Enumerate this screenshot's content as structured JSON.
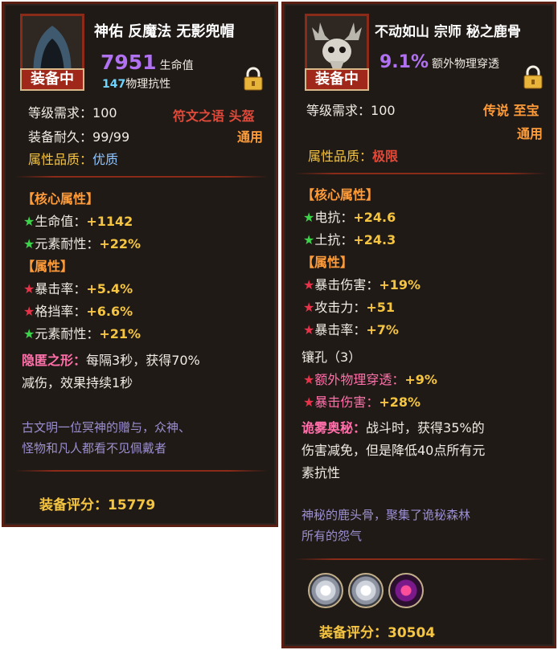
{
  "left": {
    "badge": "装备中",
    "name": "神佑 反魔法 无影兜帽",
    "main_stat_value": "7951",
    "main_stat_label": "生命值",
    "sub_stat_value": "147",
    "sub_stat_label": "物理抗性",
    "level_label": "等级需求：",
    "level_value": "100",
    "rune_text": "符文之语",
    "slot_text": "头盔",
    "durability_label": "装备耐久：",
    "durability_value": "99/99",
    "usage": "通用",
    "quality_label": "属性品质：",
    "quality_value": "优质",
    "core_title": "【核心属性】",
    "core": [
      {
        "label": "生命值：",
        "value": "+1142"
      },
      {
        "label": "元素耐性：",
        "value": "+22%"
      }
    ],
    "attr_title": "【属性】",
    "attrs": [
      {
        "star": "red",
        "label": "暴击率：",
        "value": "+5.4%"
      },
      {
        "star": "red",
        "label": "格挡率：",
        "value": "+6.6%"
      },
      {
        "star": "green",
        "label": "元素耐性：",
        "value": "+21%"
      }
    ],
    "skill_name": "隐匿之形：",
    "skill_line1": "每隔3秒，获得70%",
    "skill_line2": "减伤，效果持续1秒",
    "lore_line1": "古文明一位冥神的赠与，众神、",
    "lore_line2": "怪物和凡人都看不见佩戴者",
    "rating_label": "装备评分：",
    "rating_value": "15779"
  },
  "right": {
    "badge": "装备中",
    "name": "不动如山 宗师 秘之鹿骨",
    "main_stat_value": "9.1%",
    "main_stat_label": "额外物理穿透",
    "level_label": "等级需求：",
    "level_value": "100",
    "rarity": "传说",
    "slot_text": "至宝",
    "usage": "通用",
    "quality_label": "属性品质：",
    "quality_value": "极限",
    "core_title": "【核心属性】",
    "core": [
      {
        "label": "电抗：",
        "value": "+24.6"
      },
      {
        "label": "土抗：",
        "value": "+24.3"
      }
    ],
    "attr_title": "【属性】",
    "attrs": [
      {
        "label": "暴击伤害：",
        "value": "+19%"
      },
      {
        "label": "攻击力：",
        "value": "+51"
      },
      {
        "label": "暴击率：",
        "value": "+7%"
      }
    ],
    "socket_title": "镶孔（3）",
    "sockets": [
      {
        "label": "额外物理穿透：",
        "value": "+9%"
      },
      {
        "label": "暴击伤害：",
        "value": "+28%"
      }
    ],
    "skill_name": "诡雾奥秘：",
    "skill_line1": "战斗时，获得35%的",
    "skill_line2": "伤害减免，但是降低40点所有元",
    "skill_line3": "素抗性",
    "lore_line1": "神秘的鹿头骨，聚集了诡秘森林",
    "lore_line2": "所有的怨气",
    "gems": [
      "diamond-gem-icon",
      "diamond-gem-icon",
      "rune-gem-icon"
    ],
    "rating_label": "装备评分：",
    "rating_value": "30504"
  },
  "colors": {
    "panel_bg": "#201a16",
    "frame": "#5a1f12",
    "purple_stat": "#b072f0",
    "orange_title": "#ff9c3a",
    "red_text": "#e04a3a",
    "rating_yellow": "#f5c542",
    "lore_purple": "#9b8fd0"
  }
}
